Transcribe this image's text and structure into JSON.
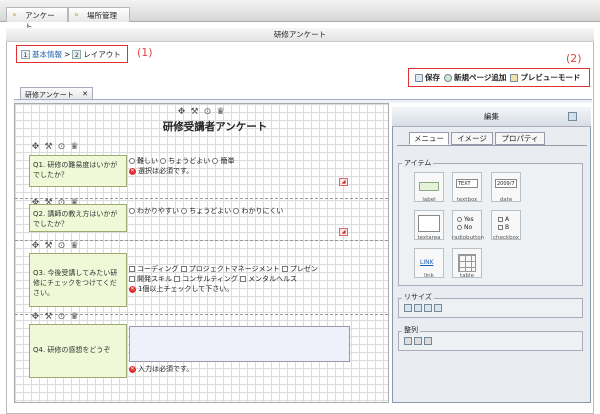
{
  "topnav": {
    "tab1": "アンケート",
    "tab2": "場所管理"
  },
  "panel_title": "研修アンケート",
  "breadcrumb": {
    "step1_num": "1",
    "step1": "基本情報",
    "sep": ">",
    "step2_num": "2",
    "step2": "レイアウト"
  },
  "annotations": {
    "a1": "(1)",
    "a2": "(2)"
  },
  "toolbar": {
    "save": "保存",
    "add_page": "新規ページ追加",
    "preview": "プレビューモード"
  },
  "doc_tab": {
    "label": "研修アンケート",
    "close": "✕"
  },
  "form": {
    "title": "研修受講者アンケート",
    "questions": [
      {
        "text": "Q1. 研修の難易度はいかがでしたか？",
        "options": [
          "難しい",
          "ちょうどよい",
          "簡単"
        ],
        "error": "選択は必須です。"
      },
      {
        "text": "Q2. 講師の教え方はいかがでしたか？",
        "options": [
          "わかりやすい",
          "ちょうどよい",
          "わかりにくい"
        ]
      },
      {
        "text": "Q3. 今後受講してみたい研修にチェックをつけてください。",
        "checks": [
          "コーディング",
          "プロジェクトマネージメント",
          "プレゼン",
          "開発スキル",
          "コンサルティング",
          "メンタルヘルス"
        ],
        "error": "1個以上チェックして下さい。"
      },
      {
        "text": "Q4. 研修の感想をどうぞ",
        "error": "入力は必須です。"
      }
    ]
  },
  "side_panel": {
    "title": "編集",
    "tabs": [
      "メニュー",
      "イメージ",
      "プロパティ"
    ],
    "items_label": "アイテム",
    "widgets": [
      {
        "name": "label"
      },
      {
        "name": "textbox"
      },
      {
        "name": "date"
      },
      {
        "name": "textarea"
      },
      {
        "name": "radiobutton"
      },
      {
        "name": "checkbox"
      },
      {
        "name": "link"
      },
      {
        "name": "table"
      }
    ],
    "widget_text": {
      "textbox": "TEXT",
      "date": "2009/7",
      "yes": "Yes",
      "no": "No",
      "a": "A",
      "b": "B",
      "link": "LINK"
    },
    "resize_label": "リサイズ",
    "align_label": "整列"
  }
}
